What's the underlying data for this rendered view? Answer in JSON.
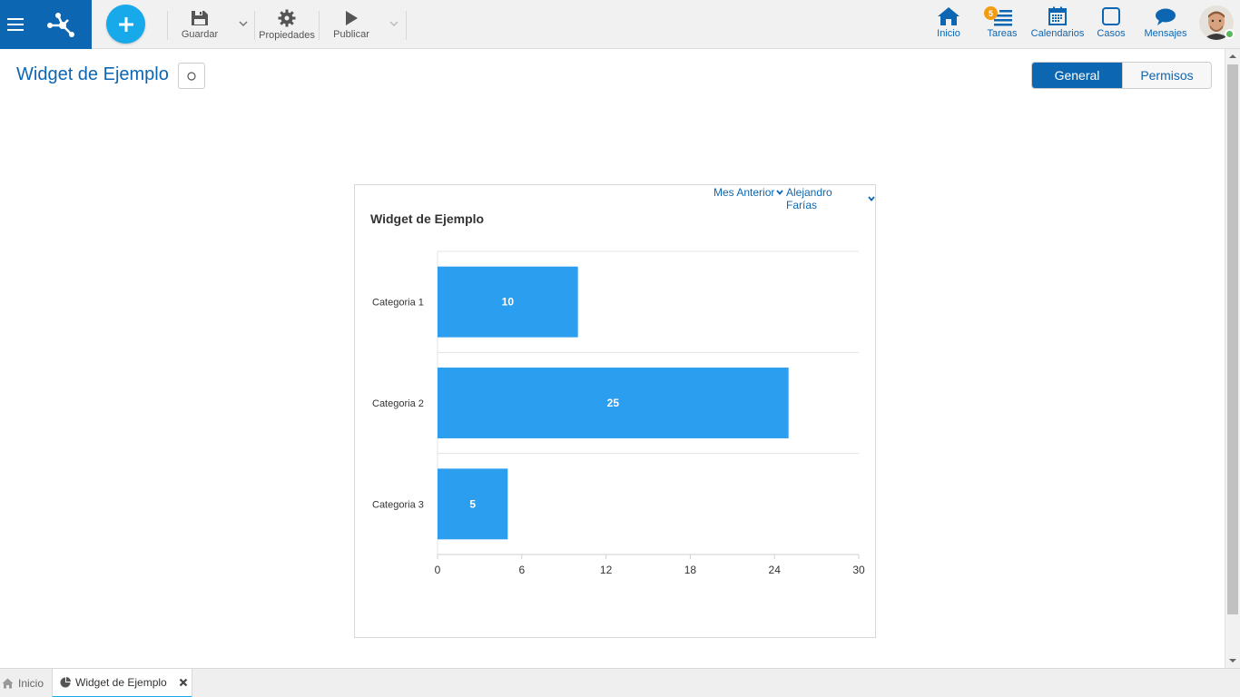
{
  "toolbar": {
    "save_label": "Guardar",
    "properties_label": "Propiedades",
    "publish_label": "Publicar"
  },
  "nav": {
    "home_label": "Inicio",
    "tasks_label": "Tareas",
    "tasks_badge": "5",
    "calendars_label": "Calendarios",
    "cases_label": "Casos",
    "messages_label": "Mensajes"
  },
  "colors": {
    "brand": "#0d66b1",
    "accent": "#17a9e9",
    "bar": "#2b9ef0",
    "badge": "#f39c12",
    "online": "#5cb85c"
  },
  "header": {
    "title": "Widget de Ejemplo",
    "tabs": [
      {
        "label": "General",
        "active": true
      },
      {
        "label": "Permisos",
        "active": false
      }
    ]
  },
  "widget": {
    "title": "Widget de Ejemplo",
    "filters": {
      "period": "Mes Anterior",
      "user": "Alejandro Farías"
    }
  },
  "chart_data": {
    "type": "bar",
    "orientation": "horizontal",
    "categories": [
      "Categoria 1",
      "Categoria 2",
      "Categoria 3"
    ],
    "values": [
      10,
      25,
      5
    ],
    "data_labels": [
      "10",
      "25",
      "5"
    ],
    "xlim": [
      0,
      30
    ],
    "x_ticks": [
      0,
      6,
      12,
      18,
      24,
      30
    ],
    "grid": true,
    "legend": "none"
  },
  "bottom_tabs": [
    {
      "label": "Inicio",
      "icon": "home-icon",
      "active": false
    },
    {
      "label": "Widget de Ejemplo",
      "icon": "pie-chart-icon",
      "active": true
    }
  ]
}
